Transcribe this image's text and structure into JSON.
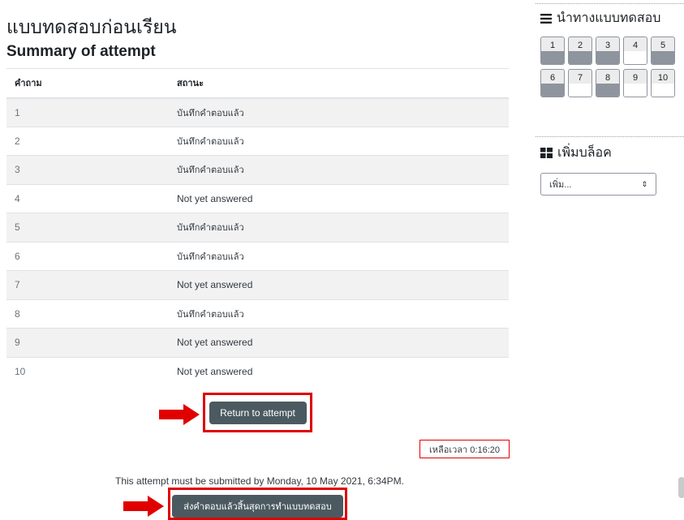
{
  "quiz": {
    "title": "แบบทดสอบก่อนเรียน",
    "subtitle": "Summary of attempt",
    "columns": {
      "question": "คำถาม",
      "status": "สถานะ"
    },
    "rows": [
      {
        "num": "1",
        "status": "บันทึกคำตอบแล้ว"
      },
      {
        "num": "2",
        "status": "บันทึกคำตอบแล้ว"
      },
      {
        "num": "3",
        "status": "บันทึกคำตอบแล้ว"
      },
      {
        "num": "4",
        "status": "Not yet answered"
      },
      {
        "num": "5",
        "status": "บันทึกคำตอบแล้ว"
      },
      {
        "num": "6",
        "status": "บันทึกคำตอบแล้ว"
      },
      {
        "num": "7",
        "status": "Not yet answered"
      },
      {
        "num": "8",
        "status": "บันทึกคำตอบแล้ว"
      },
      {
        "num": "9",
        "status": "Not yet answered"
      },
      {
        "num": "10",
        "status": "Not yet answered"
      }
    ],
    "return_button": "Return to attempt",
    "time_left": "เหลือเวลา 0:16:20",
    "deadline": "This attempt must be submitted by Monday, 10 May 2021, 6:34PM.",
    "submit_button": "ส่งคำตอบแล้วสิ้นสุดการทำแบบทดสอบ"
  },
  "sidebar": {
    "nav_title": "นำทางแบบทดสอบ",
    "nav_icon": "hamburger-icon",
    "questions": [
      {
        "num": "1",
        "answered": true
      },
      {
        "num": "2",
        "answered": true
      },
      {
        "num": "3",
        "answered": true
      },
      {
        "num": "4",
        "answered": false
      },
      {
        "num": "5",
        "answered": true
      },
      {
        "num": "6",
        "answered": true
      },
      {
        "num": "7",
        "answered": false
      },
      {
        "num": "8",
        "answered": true
      },
      {
        "num": "9",
        "answered": false
      },
      {
        "num": "10",
        "answered": false
      }
    ],
    "add_block_title": "เพิ่มบล็อค",
    "add_block_icon": "blocks-icon",
    "add_select_value": "เพิ่ม..."
  },
  "colors": {
    "button_bg": "#4b5a60",
    "highlight_red": "#e00000",
    "answered_fill": "#8f959e"
  }
}
